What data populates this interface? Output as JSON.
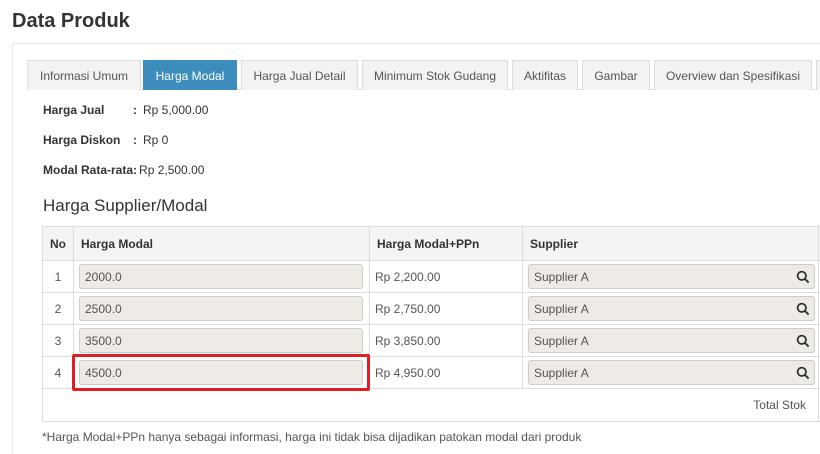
{
  "page": {
    "title": "Data Produk"
  },
  "tabs": [
    {
      "label": "Informasi Umum"
    },
    {
      "label": "Harga Modal"
    },
    {
      "label": "Harga Jual Detail"
    },
    {
      "label": "Minimum Stok Gudang"
    },
    {
      "label": "Aktifitas"
    },
    {
      "label": "Gambar"
    },
    {
      "label": "Overview dan Spesifikasi"
    }
  ],
  "active_tab": "Harga Modal",
  "info": {
    "harga_jual_label": "Harga Jual",
    "harga_jual_value": "Rp 5,000.00",
    "harga_diskon_label": "Harga Diskon",
    "harga_diskon_value": "Rp 0",
    "modal_label": "Modal Rata-rata",
    "modal_value": "Rp 2,500.00",
    "colon": ":"
  },
  "section": {
    "title": "Harga Supplier/Modal"
  },
  "table": {
    "headers": {
      "no": "No",
      "harga_modal": "Harga Modal",
      "harga_ppn": "Harga Modal+PPn",
      "supplier": "Supplier"
    },
    "rows": [
      {
        "no": "1",
        "harga_modal": "2000.0",
        "harga_ppn": "Rp 2,200.00",
        "supplier": "Supplier A"
      },
      {
        "no": "2",
        "harga_modal": "2500.0",
        "harga_ppn": "Rp 2,750.00",
        "supplier": "Supplier A"
      },
      {
        "no": "3",
        "harga_modal": "3500.0",
        "harga_ppn": "Rp 3,850.00",
        "supplier": "Supplier A"
      },
      {
        "no": "4",
        "harga_modal": "4500.0",
        "harga_ppn": "Rp 4,950.00",
        "supplier": "Supplier A"
      }
    ],
    "footer": "Total Stok"
  },
  "footnote": "*Harga Modal+PPn hanya sebagai informasi, harga ini tidak bisa dijadikan patokan modal dari produk",
  "colors": {
    "accent": "#3c8dbc",
    "highlight": "#e01e24",
    "input_bg": "#eeeae6"
  },
  "icons": {
    "supplier_search": "search-icon"
  }
}
